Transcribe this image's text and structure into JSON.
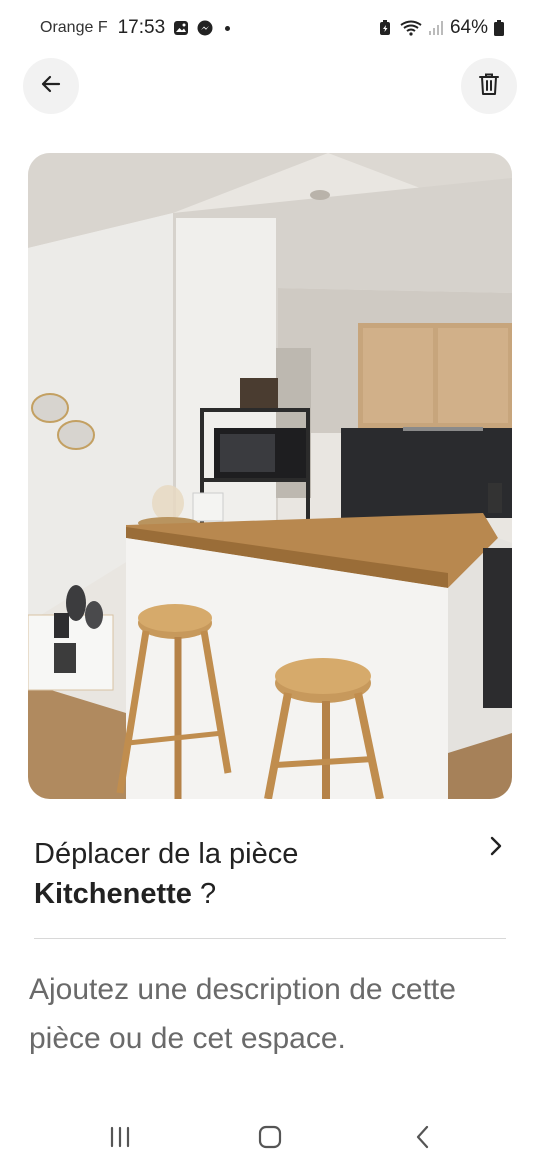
{
  "status_bar": {
    "carrier": "Orange F",
    "time": "17:53",
    "battery": "64%",
    "icons": [
      "gallery-icon",
      "messenger-icon",
      "battery-saver-icon",
      "wifi-icon",
      "signal-icon",
      "battery-icon"
    ]
  },
  "header": {
    "back_icon": "arrow-left-icon",
    "delete_icon": "trash-icon"
  },
  "photo": {
    "subject": "kitchenette"
  },
  "move_room": {
    "prefix": "Déplacer de la pièce",
    "room": "Kitchenette",
    "suffix": " ?",
    "icon": "chevron-right-icon"
  },
  "description": {
    "placeholder": "Ajoutez une description de cette pièce ou de cet espace."
  },
  "nav_bar": {
    "icons": [
      "recents-icon",
      "home-icon",
      "back-icon"
    ]
  }
}
